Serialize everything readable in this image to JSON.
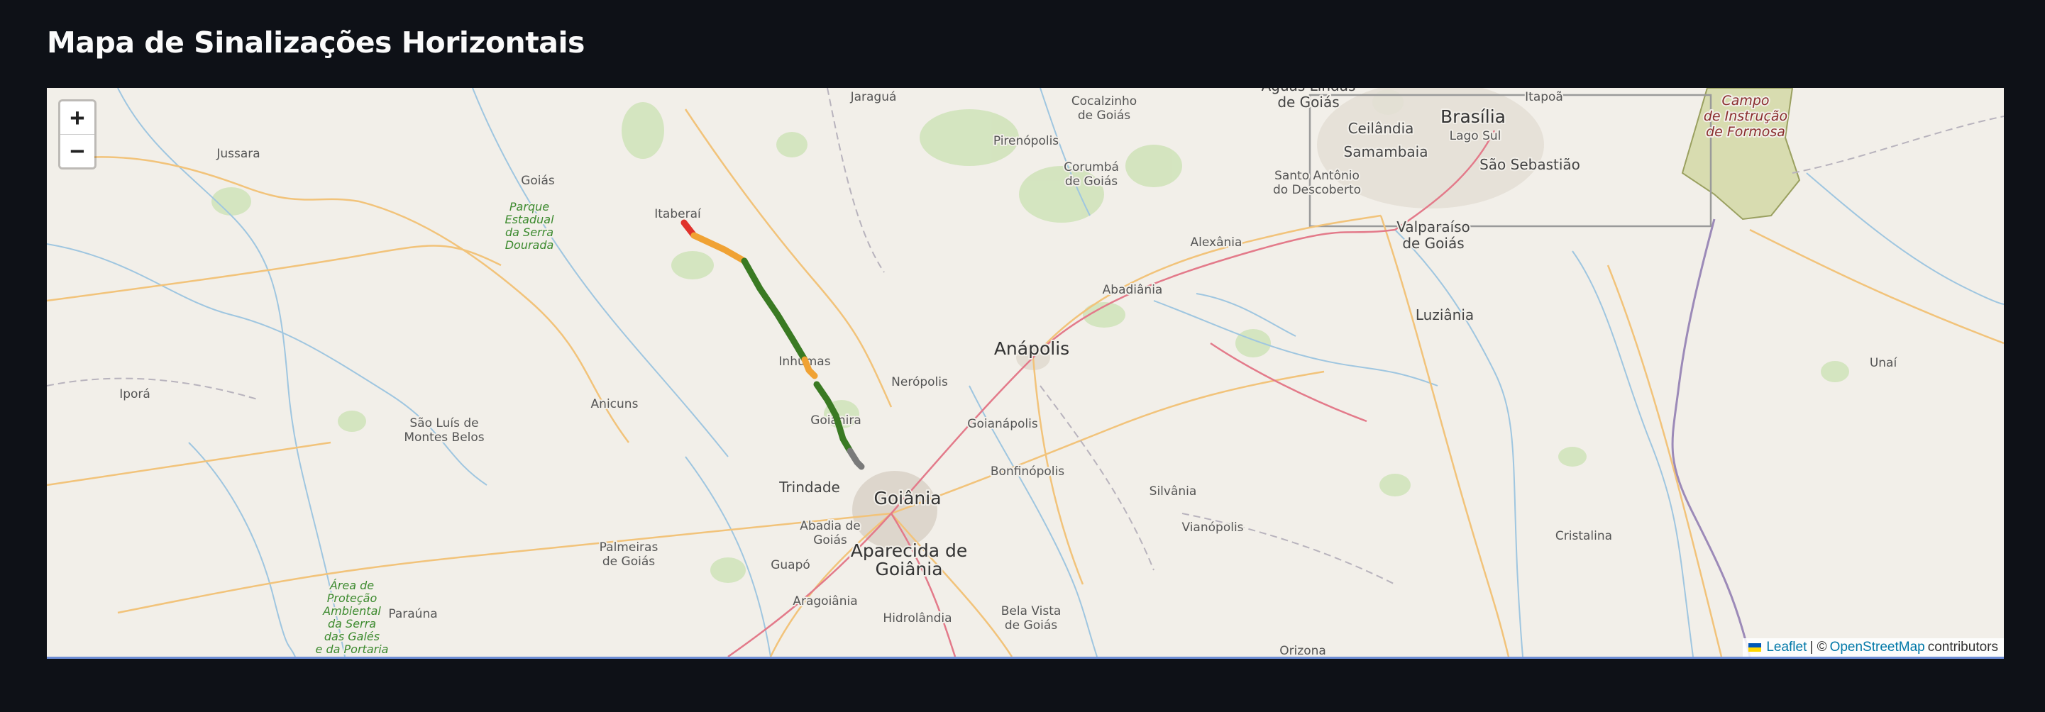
{
  "page": {
    "title": "Mapa de Sinalizações Horizontais"
  },
  "map": {
    "zoom_in_label": "+",
    "zoom_out_label": "−",
    "attribution": {
      "leaflet": "Leaflet",
      "separator": "| ©",
      "osm": "OpenStreetMap",
      "contributors": "contributors"
    },
    "places": [
      {
        "name": "Jaraguá",
        "size": "small"
      },
      {
        "name": "Cocalzinho",
        "size": "small"
      },
      {
        "name": "de Goiás",
        "size": "small"
      },
      {
        "name": "Águas Lindas",
        "size": "medium"
      },
      {
        "name": "de Goiás",
        "size": "medium"
      },
      {
        "name": "Brasília",
        "size": "large"
      },
      {
        "name": "Itapoã",
        "size": "small"
      },
      {
        "name": "Ceilândia",
        "size": "medium"
      },
      {
        "name": "Lago Sul",
        "size": "small"
      },
      {
        "name": "Samambaia",
        "size": "medium"
      },
      {
        "name": "São Sebastião",
        "size": "medium"
      },
      {
        "name": "Jussara",
        "size": "small"
      },
      {
        "name": "Goiás",
        "size": "small"
      },
      {
        "name": "Pirenópolis",
        "size": "small"
      },
      {
        "name": "Corumbá",
        "size": "small"
      },
      {
        "name": "de Goiás",
        "size": "small"
      },
      {
        "name": "Santo Antônio",
        "size": "small"
      },
      {
        "name": "do Descoberto",
        "size": "small"
      },
      {
        "name": "Itaberaí",
        "size": "small"
      },
      {
        "name": "Valparaíso",
        "size": "medium"
      },
      {
        "name": "de Goiás",
        "size": "medium"
      },
      {
        "name": "Alexânia",
        "size": "small"
      },
      {
        "name": "Abadiânia",
        "size": "small"
      },
      {
        "name": "Luziânia",
        "size": "medium"
      },
      {
        "name": "Inhumas",
        "size": "small"
      },
      {
        "name": "Anápolis",
        "size": "large"
      },
      {
        "name": "Iporá",
        "size": "small"
      },
      {
        "name": "Anicuns",
        "size": "small"
      },
      {
        "name": "Nerópolis",
        "size": "small"
      },
      {
        "name": "Unaí",
        "size": "small"
      },
      {
        "name": "São Luís de",
        "size": "small"
      },
      {
        "name": "Montes Belos",
        "size": "small"
      },
      {
        "name": "Goianira",
        "size": "small"
      },
      {
        "name": "Goianápolis",
        "size": "small"
      },
      {
        "name": "Bonfinópolis",
        "size": "small"
      },
      {
        "name": "Trindade",
        "size": "medium"
      },
      {
        "name": "Goiânia",
        "size": "large"
      },
      {
        "name": "Silvânia",
        "size": "small"
      },
      {
        "name": "Abadia de",
        "size": "small"
      },
      {
        "name": "Goiás",
        "size": "small"
      },
      {
        "name": "Vianópolis",
        "size": "small"
      },
      {
        "name": "Palmeiras",
        "size": "small"
      },
      {
        "name": "de Goiás",
        "size": "small"
      },
      {
        "name": "Guapó",
        "size": "small"
      },
      {
        "name": "Aparecida de",
        "size": "large"
      },
      {
        "name": "Goiânia",
        "size": "large"
      },
      {
        "name": "Cristalina",
        "size": "small"
      },
      {
        "name": "Aragoiânia",
        "size": "small"
      },
      {
        "name": "Paraúna",
        "size": "small"
      },
      {
        "name": "Hidrolândia",
        "size": "small"
      },
      {
        "name": "Bela Vista",
        "size": "small"
      },
      {
        "name": "de Goiás",
        "size": "small"
      },
      {
        "name": "Orizona",
        "size": "small"
      }
    ],
    "park_labels": [
      {
        "lines": [
          "Parque",
          "Estadual",
          "da Serra",
          "Dourada"
        ]
      },
      {
        "lines": [
          "Área de",
          "Proteção",
          "Ambiental",
          "da Serra",
          "das Galés",
          "e da Portaria"
        ]
      }
    ],
    "military_label": {
      "lines": [
        "Campo",
        "de Instrução",
        "de Formosa"
      ]
    },
    "segments": [
      {
        "status": "ruim",
        "color": "#e0322b"
      },
      {
        "status": "regular",
        "color": "#f0a234"
      },
      {
        "status": "bom",
        "color": "#3a7a23"
      },
      {
        "status": "regular",
        "color": "#f0a234"
      },
      {
        "status": "bom",
        "color": "#3a7a23"
      },
      {
        "status": "sem-dados",
        "color": "#7a7a7a"
      }
    ]
  }
}
